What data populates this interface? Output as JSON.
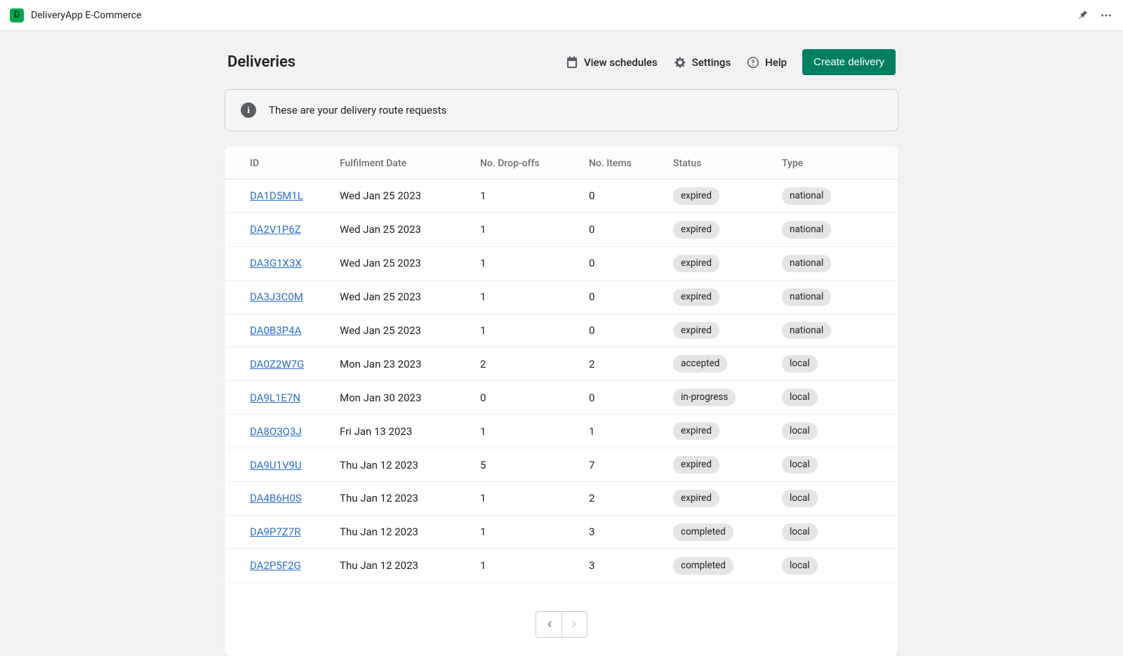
{
  "app": {
    "name": "DeliveryApp E-Commerce",
    "icon_letter": "D"
  },
  "page": {
    "title": "Deliveries"
  },
  "actions": {
    "view_schedules": "View schedules",
    "settings": "Settings",
    "help": "Help",
    "create": "Create delivery"
  },
  "banner": {
    "icon": "i",
    "text": "These are your delivery route requests"
  },
  "table": {
    "headers": {
      "id": "ID",
      "date": "Fulfilment Date",
      "dropoffs": "No. Drop-offs",
      "items": "No. Items",
      "status": "Status",
      "type": "Type"
    },
    "rows": [
      {
        "id": "DA1D5M1L",
        "date": "Wed Jan 25 2023",
        "dropoffs": "1",
        "items": "0",
        "status": "expired",
        "type": "national"
      },
      {
        "id": "DA2V1P6Z",
        "date": "Wed Jan 25 2023",
        "dropoffs": "1",
        "items": "0",
        "status": "expired",
        "type": "national"
      },
      {
        "id": "DA3G1X3X",
        "date": "Wed Jan 25 2023",
        "dropoffs": "1",
        "items": "0",
        "status": "expired",
        "type": "national"
      },
      {
        "id": "DA3J3C0M",
        "date": "Wed Jan 25 2023",
        "dropoffs": "1",
        "items": "0",
        "status": "expired",
        "type": "national"
      },
      {
        "id": "DA0B3P4A",
        "date": "Wed Jan 25 2023",
        "dropoffs": "1",
        "items": "0",
        "status": "expired",
        "type": "national"
      },
      {
        "id": "DA0Z2W7G",
        "date": "Mon Jan 23 2023",
        "dropoffs": "2",
        "items": "2",
        "status": "accepted",
        "type": "local"
      },
      {
        "id": "DA9L1E7N",
        "date": "Mon Jan 30 2023",
        "dropoffs": "0",
        "items": "0",
        "status": "in-progress",
        "type": "local"
      },
      {
        "id": "DA8O3Q3J",
        "date": "Fri Jan 13 2023",
        "dropoffs": "1",
        "items": "1",
        "status": "expired",
        "type": "local"
      },
      {
        "id": "DA9U1V9U",
        "date": "Thu Jan 12 2023",
        "dropoffs": "5",
        "items": "7",
        "status": "expired",
        "type": "local"
      },
      {
        "id": "DA4B6H0S",
        "date": "Thu Jan 12 2023",
        "dropoffs": "1",
        "items": "2",
        "status": "expired",
        "type": "local"
      },
      {
        "id": "DA9P7Z7R",
        "date": "Thu Jan 12 2023",
        "dropoffs": "1",
        "items": "3",
        "status": "completed",
        "type": "local"
      },
      {
        "id": "DA2P5F2G",
        "date": "Thu Jan 12 2023",
        "dropoffs": "1",
        "items": "3",
        "status": "completed",
        "type": "local"
      }
    ]
  }
}
